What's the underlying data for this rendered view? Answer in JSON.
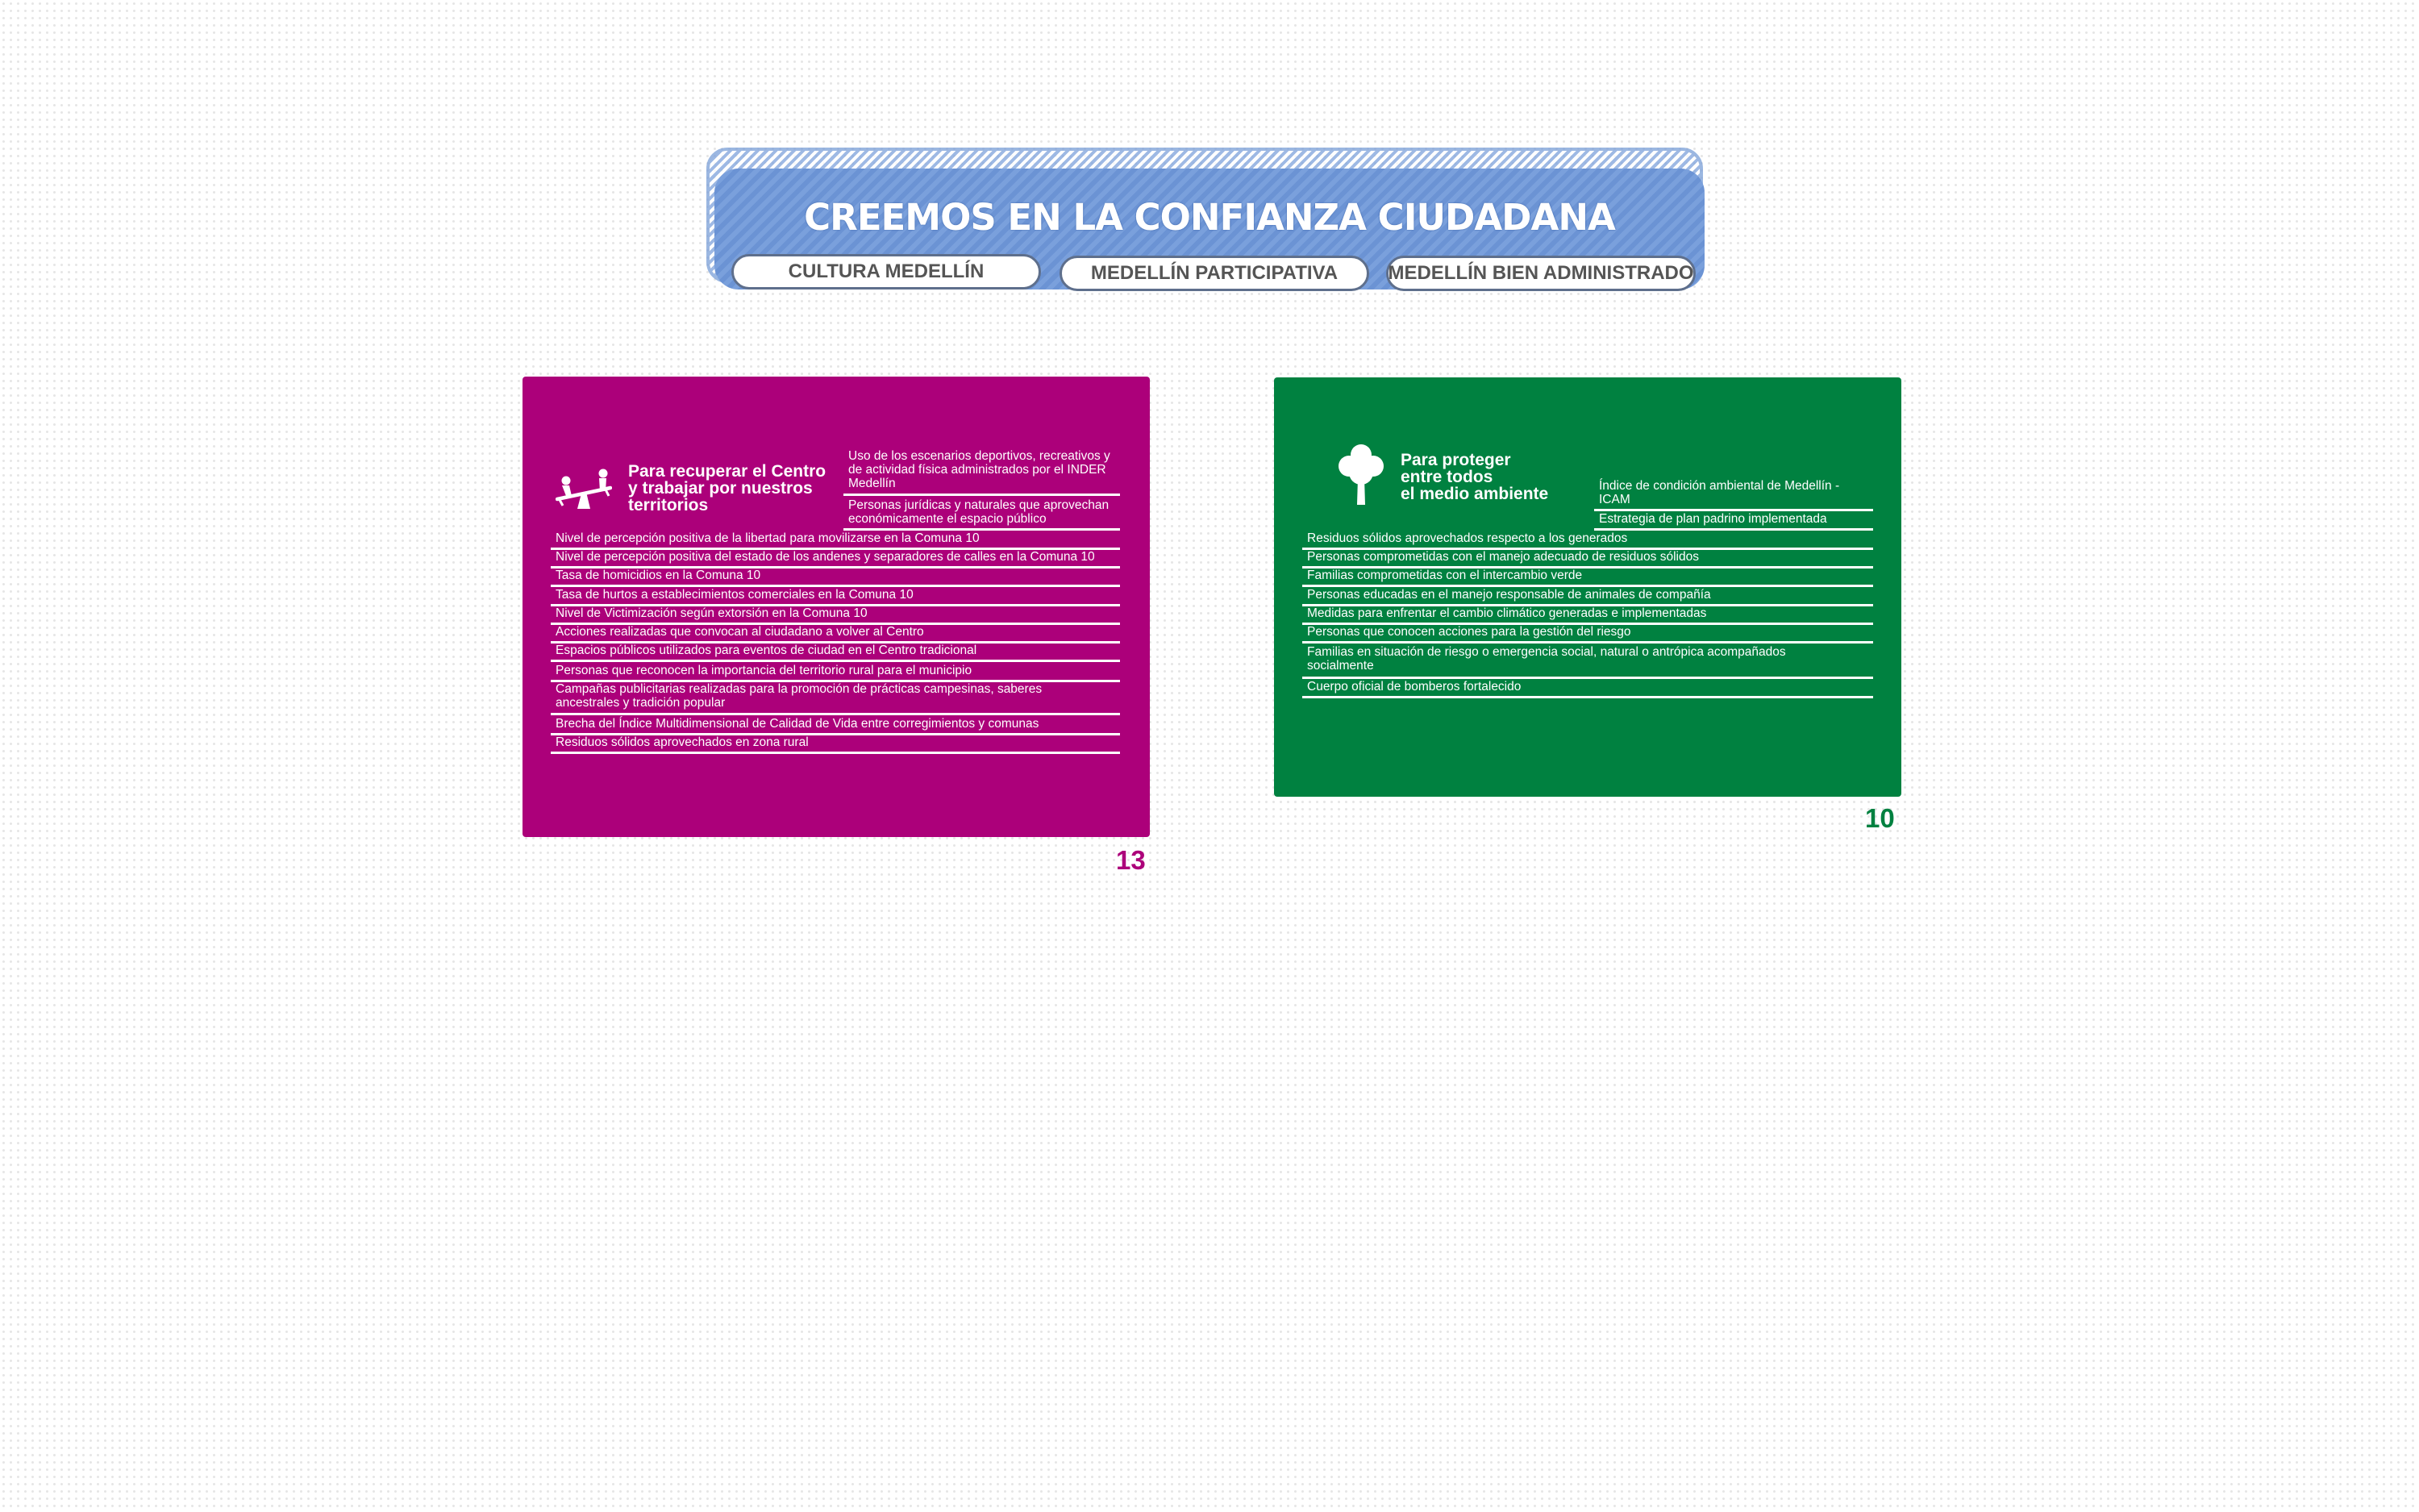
{
  "banner": {
    "title": "CREEMOS EN LA CONFIANZA CIUDADANA",
    "pills": [
      "CULTURA MEDELLÍN",
      "MEDELLÍN PARTICIPATIVA",
      "MEDELLÍN BIEN ADMINISTRADO"
    ]
  },
  "colors": {
    "magenta": "#ac007a",
    "green": "#008140",
    "banner_blue": "#6b93d4"
  },
  "panel_left": {
    "icon": "seesaw-icon",
    "heading": [
      "Para recuperar el Centro",
      "y trabajar por nuestros",
      "territorios"
    ],
    "side_indicators": [
      "Uso de los escenarios deportivos, recreativos y de actividad física administrados por el INDER Medellín",
      "Personas jurídicas y naturales que aprovechan económicamente el espacio público"
    ],
    "indicators": [
      "Nivel de percepción positiva de la libertad para movilizarse en la Comuna 10",
      "Nivel de percepción positiva del estado de los andenes y separadores de calles en la Comuna 10",
      "Tasa de homicidios en la Comuna 10",
      "Tasa de hurtos a establecimientos comerciales en la Comuna 10",
      "Nivel de Victimización según extorsión en la Comuna 10",
      "Acciones  realizadas que convocan al ciudadano a volver al Centro",
      "Espacios públicos utilizados para eventos de ciudad en el Centro tradicional",
      "Personas que reconocen la importancia del territorio rural para el municipio",
      "Campañas publicitarias realizadas para la promoción de prácticas campesinas, saberes ancestrales y tradición popular",
      "Brecha del Índice Multidimensional de Calidad de Vida entre corregimientos y comunas",
      "Residuos sólidos aprovechados en zona rural"
    ],
    "page_number": "13"
  },
  "panel_right": {
    "icon": "tree-icon",
    "heading": [
      "Para proteger",
      "entre todos",
      "el medio ambiente"
    ],
    "side_indicators": [
      "Índice de condición ambiental de Medellín -ICAM",
      "Estrategia de plan padrino implementada"
    ],
    "indicators": [
      "Residuos sólidos aprovechados respecto a los generados",
      "Personas comprometidas con el manejo adecuado de residuos sólidos",
      "Familias comprometidas con el intercambio verde",
      "Personas educadas en el manejo responsable de animales de compañía",
      "Medidas para enfrentar el cambio climático generadas e implementadas",
      "Personas que conocen acciones para la gestión del riesgo",
      "Familias en situación de riesgo o emergencia  social, natural o antrópica  acompañados socialmente",
      "Cuerpo oficial de bomberos fortalecido"
    ],
    "page_number": "10"
  }
}
